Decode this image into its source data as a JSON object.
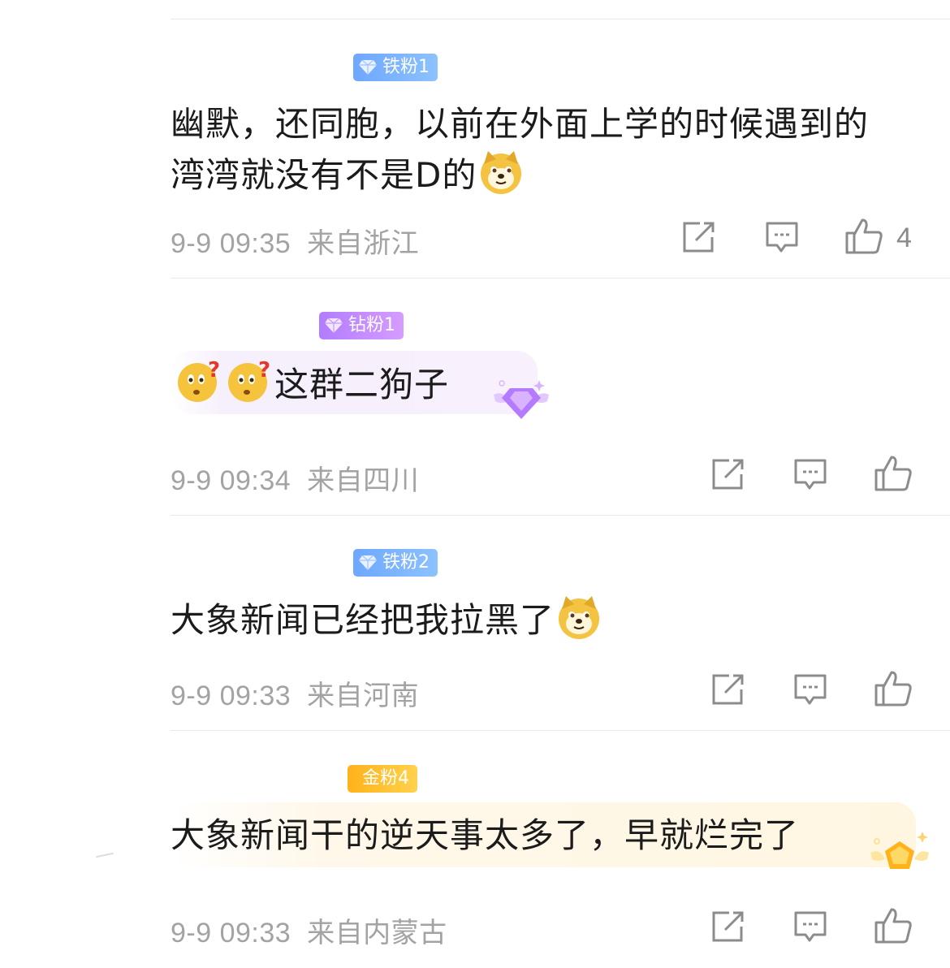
{
  "comments": [
    {
      "badge": "铁粉1",
      "text_line1": "幽默，还同胞，以前在外面上学的时候遇到的",
      "text_line2": "湾湾就没有不是D的",
      "time": "9-9 09:35",
      "location": "来自浙江",
      "likes": "4"
    },
    {
      "badge": "钻粉1",
      "text": "这群二狗子",
      "time": "9-9 09:34",
      "location": "来自四川"
    },
    {
      "badge": "铁粉2",
      "text": "大象新闻已经把我拉黑了",
      "time": "9-9 09:33",
      "location": "来自河南"
    },
    {
      "badge": "金粉4",
      "text": "大象新闻干的逆天事太多了，早就烂完了",
      "time": "9-9 09:33",
      "location": "来自内蒙古"
    }
  ],
  "colors": {
    "iron_badge": "#6ea7ff",
    "diamond_badge": "#b27cff",
    "gold_badge": "#ffb21a",
    "meta_text": "#a3a3a3",
    "icon_stroke": "#8c8c8c"
  },
  "icons": [
    "share-icon",
    "reply-icon",
    "like-icon",
    "doge-emoji",
    "confused-emoji",
    "diamond-gem-icon",
    "gold-crown-icon"
  ]
}
